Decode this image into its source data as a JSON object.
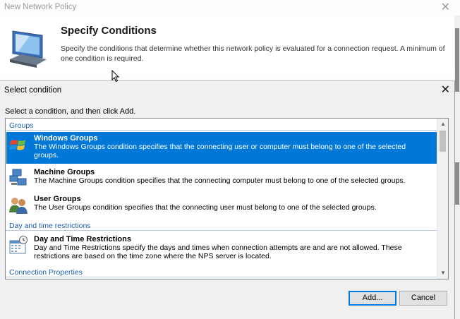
{
  "wizard": {
    "title": "New Network Policy",
    "heading": "Specify Conditions",
    "description": "Specify the conditions that determine whether this network policy is evaluated for a connection request. A minimum of one condition is required."
  },
  "dialog": {
    "title": "Select condition",
    "instruction": "Select a condition, and then click Add.",
    "categories": [
      "Groups",
      "Day and time restrictions",
      "Connection Properties"
    ],
    "items": [
      {
        "name": "Windows Groups",
        "description": "The Windows Groups condition specifies that the connecting user or computer must belong to one of the selected groups.",
        "icon": "windows-flag-icon",
        "selected": true
      },
      {
        "name": "Machine Groups",
        "description": "The Machine Groups condition specifies that the connecting computer must belong to one of the selected groups.",
        "icon": "machine-group-icon",
        "selected": false
      },
      {
        "name": "User Groups",
        "description": "The User Groups condition specifies that the connecting user must belong to one of the selected groups.",
        "icon": "user-group-icon",
        "selected": false
      },
      {
        "name": "Day and Time Restrictions",
        "description": "Day and Time Restrictions specify the days and times when connection attempts are and are not allowed. These restrictions are based on the time zone where the NPS server is located.",
        "icon": "calendar-clock-icon",
        "selected": false
      }
    ],
    "buttons": {
      "add": "Add...",
      "cancel": "Cancel"
    }
  },
  "colors": {
    "selection": "#0078d7",
    "category_text": "#1c5da8"
  }
}
